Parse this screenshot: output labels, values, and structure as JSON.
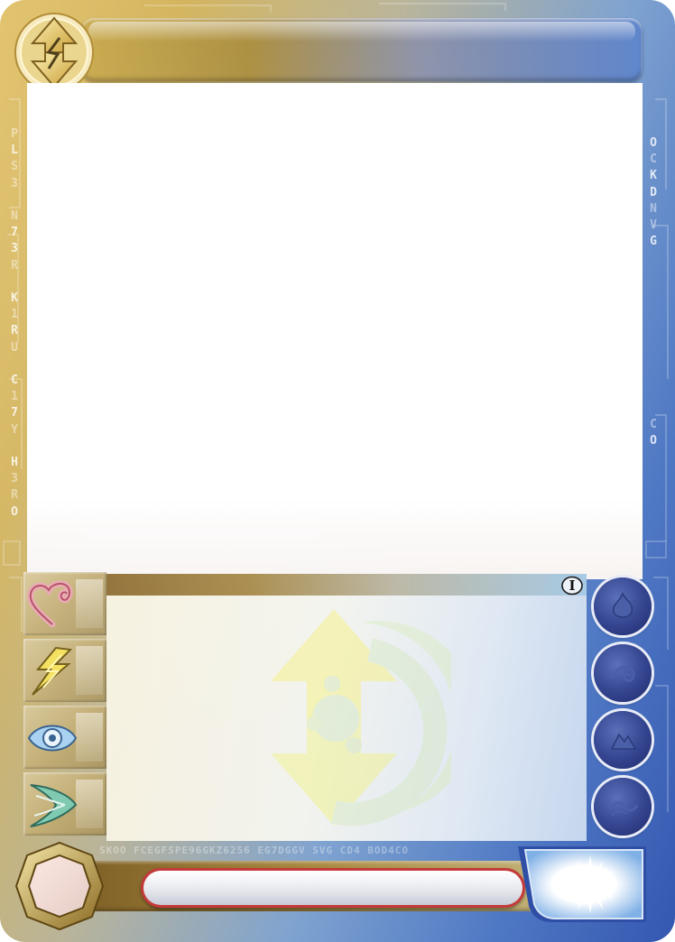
{
  "card": {
    "title": "",
    "card_name": "",
    "rules_text": "",
    "level_symbol": "I",
    "left_side_code": [
      "P",
      "L",
      "S",
      "3",
      "N",
      "7",
      "3",
      "R",
      "K",
      "1",
      "R",
      "U",
      "C",
      "1",
      "7",
      "Y",
      "H",
      "3",
      "R",
      "O"
    ],
    "right_side_code": [
      "O",
      "C",
      "K",
      "D",
      "N",
      "V",
      "G"
    ],
    "right_side_code_lower": [
      "C",
      "O"
    ],
    "bottom_code": "SKOO FCEGFSPE96GKZ6256 EG7DGGV SVG CD4 BOD4CO"
  },
  "stats": [
    {
      "name": "energy",
      "icon": "heart-icon",
      "value": ""
    },
    {
      "name": "power",
      "icon": "lightning-icon",
      "value": ""
    },
    {
      "name": "wisdom",
      "icon": "eye-icon",
      "value": ""
    },
    {
      "name": "skill",
      "icon": "arrow-wing-icon",
      "value": ""
    }
  ],
  "element_orbs": [
    {
      "icon": "fire-icon"
    },
    {
      "icon": "air-icon"
    },
    {
      "icon": "earth-icon"
    },
    {
      "icon": "water-icon"
    }
  ],
  "colors": {
    "frame_gold": "#d3b35a",
    "frame_blue": "#3457b0",
    "orb_navy": "#34448f",
    "name_pill_border": "#c43a3a",
    "heart_pink": "#d9707f",
    "lightning_yellow": "#f1d94a",
    "eye_blue": "#7fb2e0",
    "arrow_teal": "#58b39a"
  }
}
